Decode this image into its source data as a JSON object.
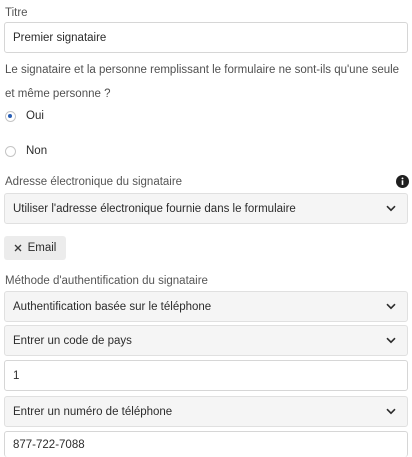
{
  "titre": {
    "label": "Titre",
    "value": "Premier signataire"
  },
  "same_person": {
    "question": "Le signataire et la personne remplissant le formulaire ne sont-ils qu'une seule et même personne ?",
    "options": [
      {
        "label": "Oui",
        "checked": true
      },
      {
        "label": "Non",
        "checked": false
      }
    ]
  },
  "email": {
    "label": "Adresse électronique du signataire",
    "info_icon": "info-circle-icon",
    "selected": "Utiliser l'adresse électronique fournie dans le formulaire",
    "chip_label": "Email",
    "chip_icon": "close-icon"
  },
  "auth": {
    "label": "Méthode d'authentification du signataire",
    "method_selected": "Authentification basée sur le téléphone",
    "country_code_placeholder": "Entrer un code de pays",
    "country_code_value": "1",
    "phone_placeholder": "Entrer un numéro de téléphone",
    "phone_value": "877-722-7088"
  },
  "colors": {
    "accent": "#2a5fb5",
    "field_border": "#d6d6d6",
    "select_bg": "#f5f5f5",
    "chip_bg": "#ececec"
  }
}
